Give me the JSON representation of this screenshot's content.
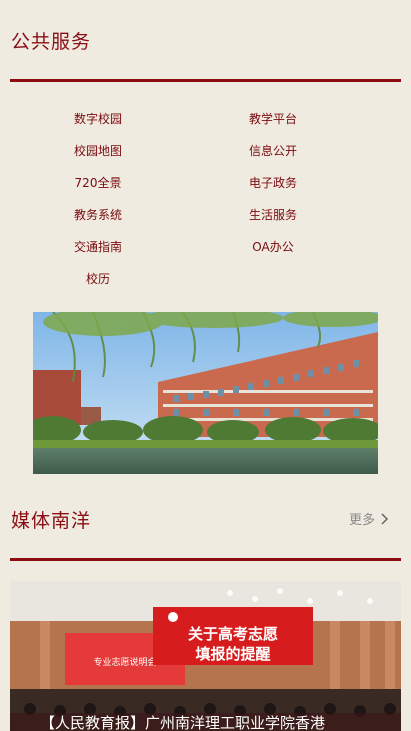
{
  "public_services": {
    "title": "公共服务",
    "links": [
      {
        "label": "数字校园"
      },
      {
        "label": "教学平台"
      },
      {
        "label": "校园地图"
      },
      {
        "label": "信息公开"
      },
      {
        "label": "720全景"
      },
      {
        "label": "电子政务"
      },
      {
        "label": "教务系统"
      },
      {
        "label": "生活服务"
      },
      {
        "label": "交通指南"
      },
      {
        "label": "OA办公"
      },
      {
        "label": "校历"
      }
    ]
  },
  "media": {
    "title": "媒体南洋",
    "more_label": "更多",
    "news": {
      "banner_line1": "关于高考志愿",
      "banner_line2": "填报的提醒",
      "screen_text": "专业志愿说明会",
      "caption": "【人民教育报】广州南洋理工职业学院香港"
    }
  },
  "colors": {
    "background": "#EFEBE0",
    "accent": "#8E0A10",
    "link": "#7A0A0F"
  }
}
